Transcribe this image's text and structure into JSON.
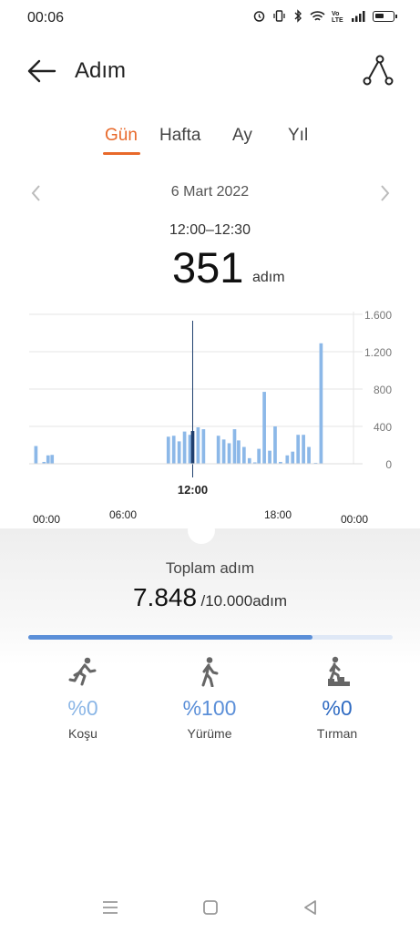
{
  "status": {
    "time": "00:06",
    "icons": [
      "alarm-icon",
      "vibrate-icon",
      "bluetooth-icon",
      "wifi-icon",
      "volte-icon",
      "signal-icon",
      "battery-icon"
    ]
  },
  "header": {
    "title": "Adım",
    "back_icon": "arrow-left-icon",
    "route_icon": "route-icon"
  },
  "tabs": [
    {
      "label": "Gün",
      "active": true
    },
    {
      "label": "Hafta",
      "active": false
    },
    {
      "label": "Ay",
      "active": false
    },
    {
      "label": "Yıl",
      "active": false
    }
  ],
  "date": "6 Mart 2022",
  "selection": {
    "range": "12:00–12:30",
    "value": "351",
    "unit": "adım"
  },
  "colors": {
    "accent": "#e8692a",
    "bar": "#8cb8e8",
    "bar_selected": "#1f3f6e",
    "progress": "#5b8fd8",
    "run": "#8bb6e6",
    "walk": "#5b8fd8",
    "climb": "#2f6bc2"
  },
  "chart_data": {
    "type": "bar",
    "title": "",
    "xlabel": "",
    "ylabel": "",
    "ylim": [
      0,
      1600
    ],
    "yticks": [
      "1.600",
      "1.200",
      "800",
      "400",
      "0"
    ],
    "ytick_values": [
      1600,
      1200,
      800,
      400,
      0
    ],
    "xtick_labels": [
      "00:00",
      "06:00",
      "12:00",
      "18:00",
      "00:00"
    ],
    "xtick_hours": [
      0,
      6,
      12,
      18,
      24
    ],
    "selected_label": "12:00",
    "selected_hour": 12.1,
    "bar_width_hours": 0.25,
    "bars": [
      {
        "h": 0.5,
        "v": 190
      },
      {
        "h": 1.1,
        "v": 20
      },
      {
        "h": 1.4,
        "v": 90
      },
      {
        "h": 1.7,
        "v": 95
      },
      {
        "h": 10.3,
        "v": 290
      },
      {
        "h": 10.7,
        "v": 300
      },
      {
        "h": 11.1,
        "v": 240
      },
      {
        "h": 11.5,
        "v": 345
      },
      {
        "h": 11.9,
        "v": 310
      },
      {
        "h": 12.1,
        "v": 351,
        "selected": true
      },
      {
        "h": 12.5,
        "v": 390
      },
      {
        "h": 12.9,
        "v": 370
      },
      {
        "h": 14.0,
        "v": 300
      },
      {
        "h": 14.4,
        "v": 260
      },
      {
        "h": 14.8,
        "v": 220
      },
      {
        "h": 15.2,
        "v": 370
      },
      {
        "h": 15.5,
        "v": 250
      },
      {
        "h": 15.9,
        "v": 180
      },
      {
        "h": 16.3,
        "v": 60
      },
      {
        "h": 16.7,
        "v": 15
      },
      {
        "h": 17.0,
        "v": 160
      },
      {
        "h": 17.4,
        "v": 770
      },
      {
        "h": 17.8,
        "v": 140
      },
      {
        "h": 18.2,
        "v": 400
      },
      {
        "h": 18.6,
        "v": 20
      },
      {
        "h": 19.1,
        "v": 90
      },
      {
        "h": 19.5,
        "v": 130
      },
      {
        "h": 19.9,
        "v": 310
      },
      {
        "h": 20.3,
        "v": 310
      },
      {
        "h": 20.7,
        "v": 180
      },
      {
        "h": 21.2,
        "v": 10
      },
      {
        "h": 21.6,
        "v": 1290
      }
    ]
  },
  "summary": {
    "label": "Toplam adım",
    "value": "7.848",
    "goal": "/10.000adım",
    "progress_fraction": 0.78
  },
  "activities": [
    {
      "key": "run",
      "icon": "running-icon",
      "percent": "%0",
      "label": "Koşu"
    },
    {
      "key": "walk",
      "icon": "walking-icon",
      "percent": "%100",
      "label": "Yürüme"
    },
    {
      "key": "climb",
      "icon": "climbing-stairs-icon",
      "percent": "%0",
      "label": "Tırman"
    }
  ],
  "navbar": {
    "icons": [
      "menu-icon",
      "home-icon",
      "back-triangle-icon"
    ]
  }
}
